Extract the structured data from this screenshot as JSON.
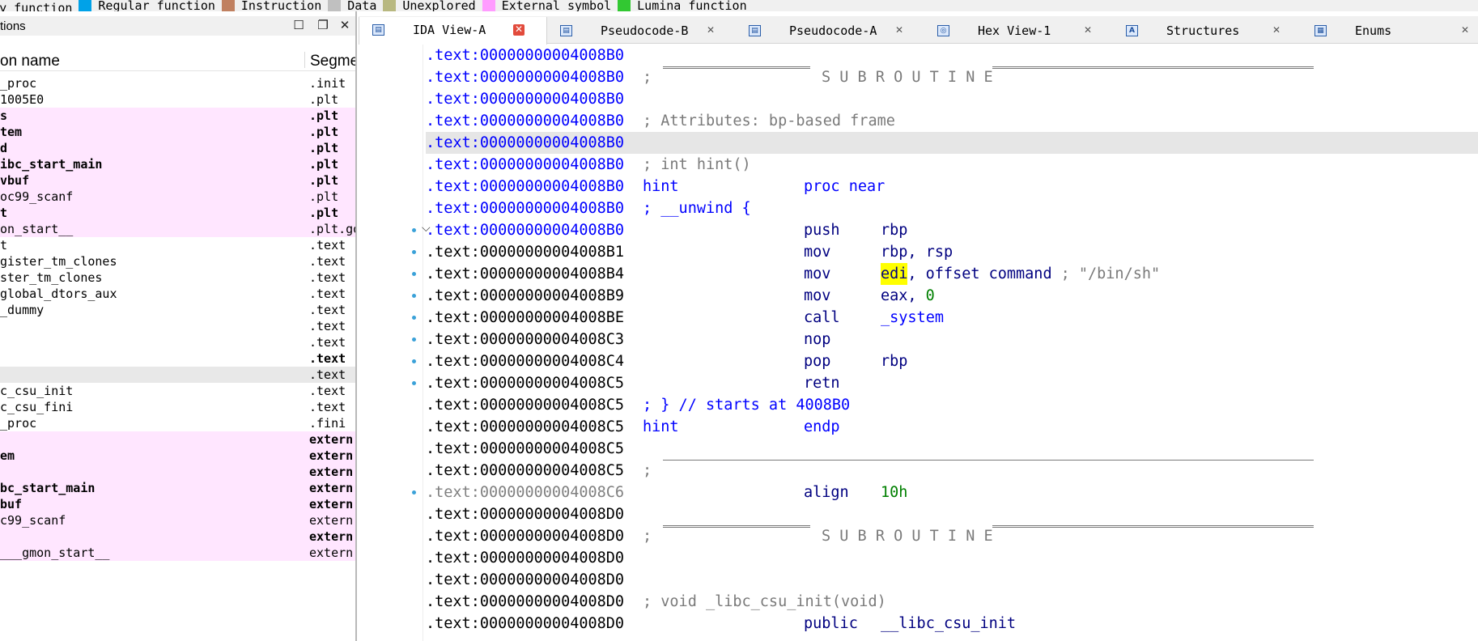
{
  "legend": [
    {
      "label": "rary function",
      "color": "#4fd0ff"
    },
    {
      "label": "Regular function",
      "color": "#00a2e8"
    },
    {
      "label": "Instruction",
      "color": "#c08060"
    },
    {
      "label": "Data",
      "color": "#c0c0c0"
    },
    {
      "label": "Unexplored",
      "color": "#b8b880"
    },
    {
      "label": "External symbol",
      "color": "#ff9cff"
    },
    {
      "label": "Lumina function",
      "color": "#32c832"
    }
  ],
  "functions_panel": {
    "title": "tions",
    "col_name": "on name",
    "col_segment": "Segme",
    "rows": [
      {
        "name": "_proc",
        "segment": ".init",
        "ext": false,
        "bold": false,
        "sel": false
      },
      {
        "name": "1005E0",
        "segment": ".plt",
        "ext": false,
        "bold": false,
        "sel": false
      },
      {
        "name": "s",
        "segment": ".plt",
        "ext": true,
        "bold": true,
        "sel": false
      },
      {
        "name": "tem",
        "segment": ".plt",
        "ext": true,
        "bold": true,
        "sel": false
      },
      {
        "name": "d",
        "segment": ".plt",
        "ext": true,
        "bold": true,
        "sel": false
      },
      {
        "name": "ibc_start_main",
        "segment": ".plt",
        "ext": true,
        "bold": true,
        "sel": false
      },
      {
        "name": "vbuf",
        "segment": ".plt",
        "ext": true,
        "bold": true,
        "sel": false
      },
      {
        "name": "oc99_scanf",
        "segment": ".plt",
        "ext": true,
        "bold": false,
        "sel": false
      },
      {
        "name": "t",
        "segment": ".plt",
        "ext": true,
        "bold": true,
        "sel": false
      },
      {
        "name": "on_start__",
        "segment": ".plt.go",
        "ext": true,
        "bold": false,
        "sel": false
      },
      {
        "name": "t",
        "segment": ".text",
        "ext": false,
        "bold": false,
        "sel": false
      },
      {
        "name": "gister_tm_clones",
        "segment": ".text",
        "ext": false,
        "bold": false,
        "sel": false
      },
      {
        "name": "ster_tm_clones",
        "segment": ".text",
        "ext": false,
        "bold": false,
        "sel": false
      },
      {
        "name": "global_dtors_aux",
        "segment": ".text",
        "ext": false,
        "bold": false,
        "sel": false
      },
      {
        "name": "_dummy",
        "segment": ".text",
        "ext": false,
        "bold": false,
        "sel": false
      },
      {
        "name": "",
        "segment": ".text",
        "ext": false,
        "bold": false,
        "sel": false
      },
      {
        "name": "",
        "segment": ".text",
        "ext": false,
        "bold": false,
        "sel": false
      },
      {
        "name": "",
        "segment": ".text",
        "ext": false,
        "bold": true,
        "sel": false
      },
      {
        "name": "",
        "segment": ".text",
        "ext": false,
        "bold": false,
        "sel": true
      },
      {
        "name": "c_csu_init",
        "segment": ".text",
        "ext": false,
        "bold": false,
        "sel": false
      },
      {
        "name": "c_csu_fini",
        "segment": ".text",
        "ext": false,
        "bold": false,
        "sel": false
      },
      {
        "name": "_proc",
        "segment": ".fini",
        "ext": false,
        "bold": false,
        "sel": false
      },
      {
        "name": "",
        "segment": "extern",
        "ext": true,
        "bold": true,
        "sel": false
      },
      {
        "name": "em",
        "segment": "extern",
        "ext": true,
        "bold": true,
        "sel": false
      },
      {
        "name": "",
        "segment": "extern",
        "ext": true,
        "bold": true,
        "sel": false
      },
      {
        "name": "bc_start_main",
        "segment": "extern",
        "ext": true,
        "bold": true,
        "sel": false
      },
      {
        "name": "buf",
        "segment": "extern",
        "ext": true,
        "bold": true,
        "sel": false
      },
      {
        "name": "c99_scanf",
        "segment": "extern",
        "ext": true,
        "bold": false,
        "sel": false
      },
      {
        "name": "",
        "segment": "extern",
        "ext": true,
        "bold": true,
        "sel": false
      },
      {
        "name": "___gmon_start__",
        "segment": "extern",
        "ext": true,
        "bold": false,
        "sel": false
      }
    ]
  },
  "tabs": [
    {
      "label": "IDA View-A",
      "icon": "ida-view-icon",
      "glyph": "▤",
      "active": true
    },
    {
      "label": "Pseudocode-B",
      "icon": "pseudocode-icon",
      "glyph": "▤",
      "active": false
    },
    {
      "label": "Pseudocode-A",
      "icon": "pseudocode-icon",
      "glyph": "▤",
      "active": false
    },
    {
      "label": "Hex View-1",
      "icon": "hex-view-icon",
      "glyph": "◎",
      "active": false
    },
    {
      "label": "Structures",
      "icon": "structures-icon",
      "glyph": "A",
      "active": false
    },
    {
      "label": "Enums",
      "icon": "enums-icon",
      "glyph": "▦",
      "active": false
    }
  ],
  "disasm": {
    "lines": [
      {
        "addr": ".text:00000000004008B0",
        "style": "blue",
        "kind": "plain",
        "text": ""
      },
      {
        "addr": ".text:00000000004008B0",
        "style": "blue",
        "kind": "subroutine",
        "text": "S U B R O U T I N E"
      },
      {
        "addr": ".text:00000000004008B0",
        "style": "blue",
        "kind": "plain",
        "text": ""
      },
      {
        "addr": ".text:00000000004008B0",
        "style": "blue",
        "kind": "comment",
        "text": "; Attributes: bp-based frame"
      },
      {
        "addr": ".text:00000000004008B0",
        "style": "blue",
        "kind": "plain",
        "text": "",
        "hl": true
      },
      {
        "addr": ".text:00000000004008B0",
        "style": "blue",
        "kind": "comment",
        "text": "; int hint()"
      },
      {
        "addr": ".text:00000000004008B0",
        "style": "blue",
        "kind": "proc",
        "label": "hint",
        "mnem": "proc near"
      },
      {
        "addr": ".text:00000000004008B0",
        "style": "blue",
        "kind": "unwind",
        "text": "; __unwind {"
      },
      {
        "addr": ".text:00000000004008B0",
        "style": "blue",
        "kind": "insn",
        "mnem": "push",
        "ops": "rbp",
        "dot": true,
        "chev": true
      },
      {
        "addr": ".text:00000000004008B1",
        "style": "black",
        "kind": "insn",
        "mnem": "mov",
        "ops": "rbp, rsp",
        "dot": true
      },
      {
        "addr": ".text:00000000004008B4",
        "style": "black",
        "kind": "insn_mark",
        "mnem": "mov",
        "op_mark": "edi",
        "op_rest": ", offset command",
        "cmt": " ; \"/bin/sh\"",
        "dot": true
      },
      {
        "addr": ".text:00000000004008B9",
        "style": "black",
        "kind": "insn_num",
        "mnem": "mov",
        "ops": "eax, ",
        "num": "0",
        "dot": true
      },
      {
        "addr": ".text:00000000004008BE",
        "style": "black",
        "kind": "insn_call",
        "mnem": "call",
        "ops": "_system",
        "dot": true
      },
      {
        "addr": ".text:00000000004008C3",
        "style": "black",
        "kind": "insn",
        "mnem": "nop",
        "ops": "",
        "dot": true
      },
      {
        "addr": ".text:00000000004008C4",
        "style": "black",
        "kind": "insn",
        "mnem": "pop",
        "ops": "rbp",
        "dot": true
      },
      {
        "addr": ".text:00000000004008C5",
        "style": "black",
        "kind": "insn",
        "mnem": "retn",
        "ops": "",
        "dot": true
      },
      {
        "addr": ".text:00000000004008C5",
        "style": "black",
        "kind": "unwind",
        "text": "; } // starts at 4008B0"
      },
      {
        "addr": ".text:00000000004008C5",
        "style": "black",
        "kind": "proc",
        "label": "hint",
        "mnem": "endp"
      },
      {
        "addr": ".text:00000000004008C5",
        "style": "black",
        "kind": "plain",
        "text": ""
      },
      {
        "addr": ".text:00000000004008C5",
        "style": "black",
        "kind": "singlerule",
        "text": ";"
      },
      {
        "addr": ".text:00000000004008C6",
        "style": "gray",
        "kind": "insn_num",
        "mnem": "align",
        "ops": "",
        "num": "10h",
        "dot": true
      },
      {
        "addr": ".text:00000000004008D0",
        "style": "black",
        "kind": "plain",
        "text": ""
      },
      {
        "addr": ".text:00000000004008D0",
        "style": "black",
        "kind": "subroutine",
        "text": "S U B R O U T I N E"
      },
      {
        "addr": ".text:00000000004008D0",
        "style": "black",
        "kind": "plain",
        "text": ""
      },
      {
        "addr": ".text:00000000004008D0",
        "style": "black",
        "kind": "plain",
        "text": ""
      },
      {
        "addr": ".text:00000000004008D0",
        "style": "black",
        "kind": "comment",
        "text": "; void _libc_csu_init(void)"
      },
      {
        "addr": ".text:00000000004008D0",
        "style": "black",
        "kind": "insn",
        "mnem": "public",
        "ops": "__libc_csu_init"
      }
    ]
  }
}
